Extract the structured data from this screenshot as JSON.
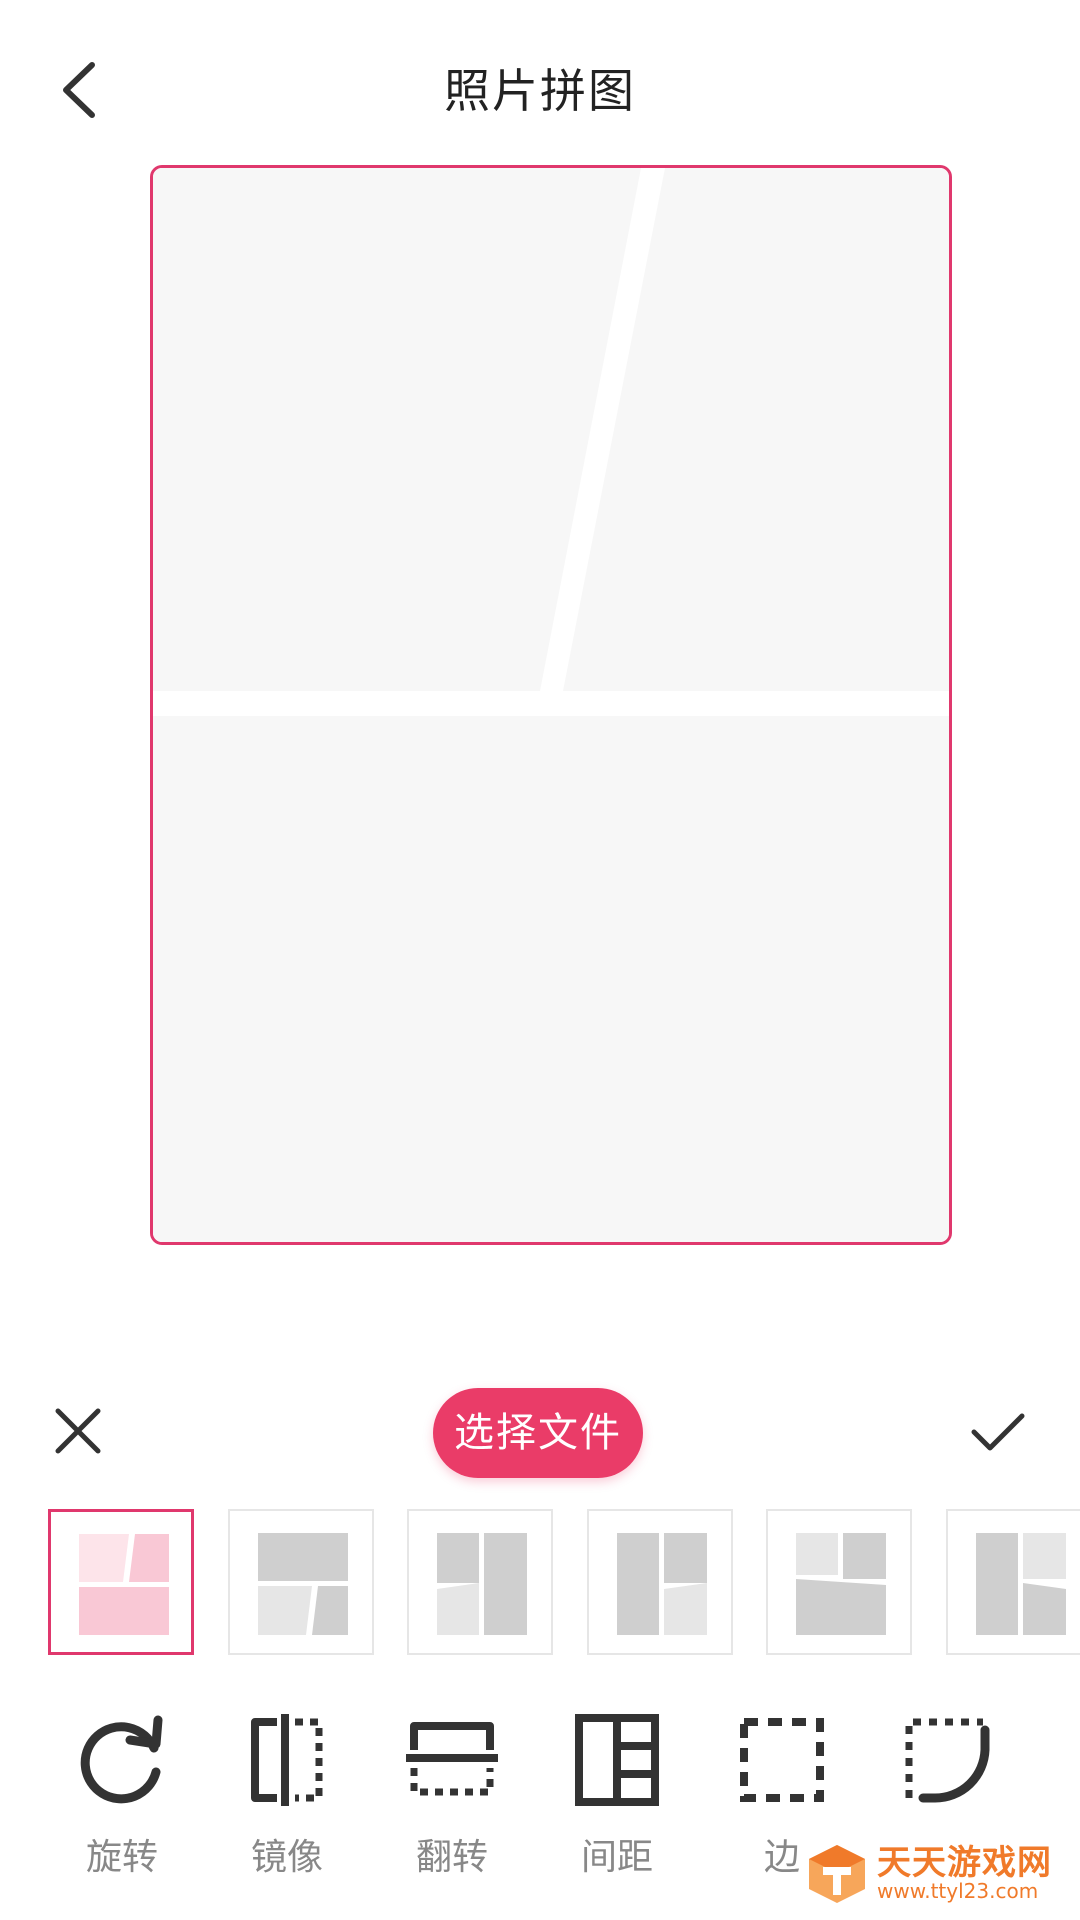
{
  "header": {
    "title": "照片拼图",
    "back_icon": "chevron-left-icon"
  },
  "canvas": {
    "border_color": "#e0386d",
    "cell_color": "#f7f7f7"
  },
  "actions": {
    "close_icon": "close-icon",
    "select_file_label": "选择文件",
    "confirm_icon": "check-icon",
    "accent_color": "#ea3c68"
  },
  "templates": [
    {
      "id": "tpl-1",
      "selected": true
    },
    {
      "id": "tpl-2",
      "selected": false
    },
    {
      "id": "tpl-3",
      "selected": false
    },
    {
      "id": "tpl-4",
      "selected": false
    },
    {
      "id": "tpl-5",
      "selected": false
    },
    {
      "id": "tpl-6",
      "selected": false
    }
  ],
  "tools": [
    {
      "label": "旋转",
      "icon": "rotate-icon"
    },
    {
      "label": "镜像",
      "icon": "mirror-icon"
    },
    {
      "label": "翻转",
      "icon": "flip-icon"
    },
    {
      "label": "间距",
      "icon": "spacing-icon"
    },
    {
      "label": "边",
      "icon": "border-icon"
    },
    {
      "label": "",
      "icon": "corner-radius-icon"
    }
  ],
  "watermark": {
    "title": "天天游戏网",
    "url": "www.ttyl23.com",
    "color": "#f07a2a"
  }
}
